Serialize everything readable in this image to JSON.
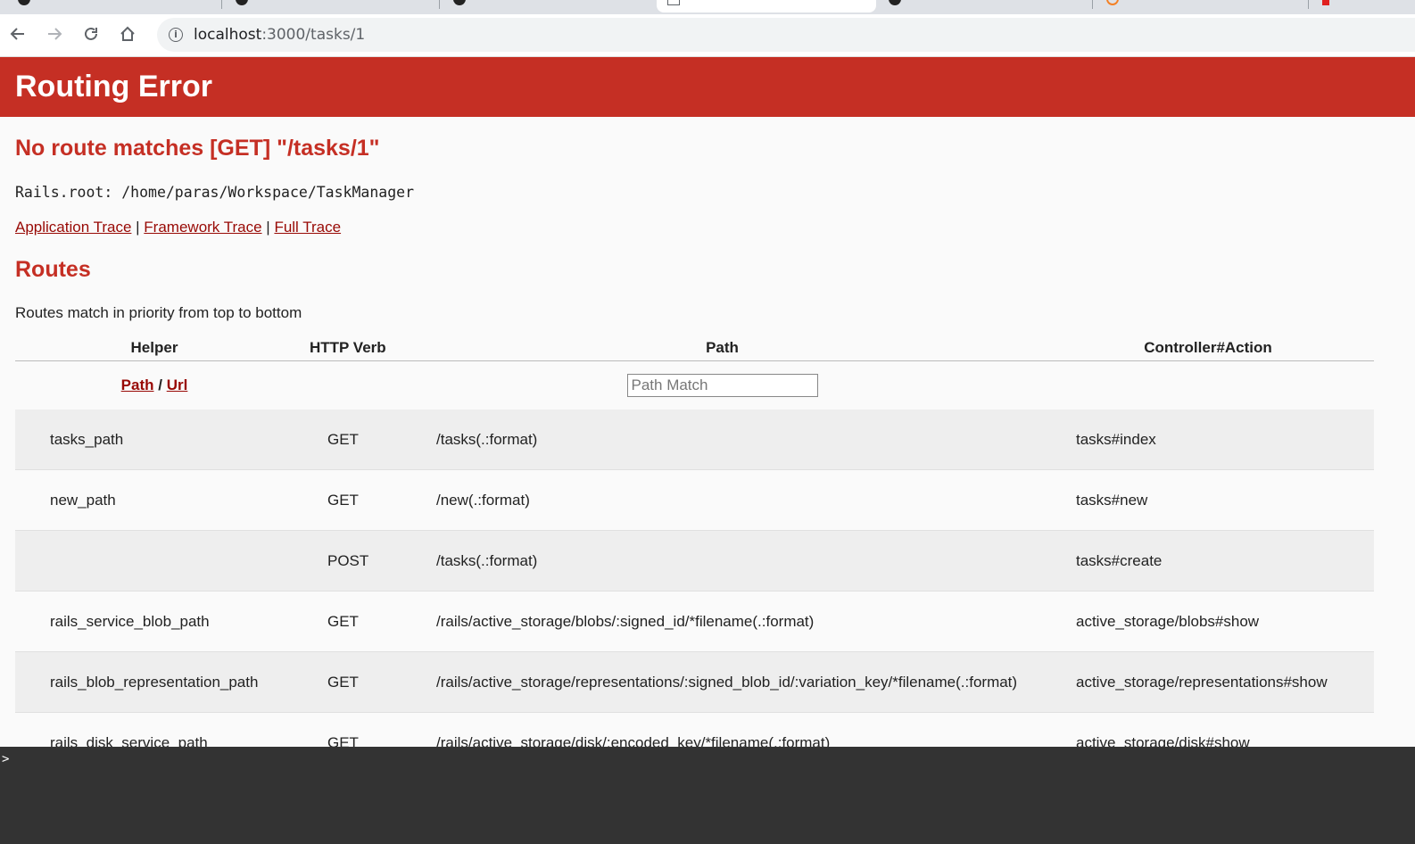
{
  "browser": {
    "url_host": "localhost",
    "url_rest": ":3000/tasks/1"
  },
  "page": {
    "header_title": "Routing Error",
    "message": "No route matches [GET] \"/tasks/1\"",
    "rails_root": "Rails.root: /home/paras/Workspace/TaskManager",
    "traces": {
      "application": "Application Trace",
      "framework": "Framework Trace",
      "full": "Full Trace",
      "separator": "|"
    },
    "routes_heading": "Routes",
    "routes_description": "Routes match in priority from top to bottom"
  },
  "routes_table": {
    "headers": {
      "helper": "Helper",
      "verb": "HTTP Verb",
      "path": "Path",
      "action": "Controller#Action"
    },
    "filter": {
      "path_link": "Path",
      "slash": "/",
      "url_link": "Url",
      "search_placeholder": "Path Match"
    },
    "rows": [
      {
        "helper": "tasks_path",
        "verb": "GET",
        "path": "/tasks(.:format)",
        "action": "tasks#index"
      },
      {
        "helper": "new_path",
        "verb": "GET",
        "path": "/new(.:format)",
        "action": "tasks#new"
      },
      {
        "helper": "",
        "verb": "POST",
        "path": "/tasks(.:format)",
        "action": "tasks#create"
      },
      {
        "helper": "rails_service_blob_path",
        "verb": "GET",
        "path": "/rails/active_storage/blobs/:signed_id/*filename(.:format)",
        "action": "active_storage/blobs#show"
      },
      {
        "helper": "rails_blob_representation_path",
        "verb": "GET",
        "path": "/rails/active_storage/representations/:signed_blob_id/:variation_key/*filename(.:format)",
        "action": "active_storage/representations#show"
      },
      {
        "helper": "rails_disk_service_path",
        "verb": "GET",
        "path": "/rails/active_storage/disk/:encoded_key/*filename(.:format)",
        "action": "active_storage/disk#show"
      }
    ]
  },
  "console": {
    "prompt": ">"
  },
  "colors": {
    "accent_red": "#c52f24",
    "link_red": "#980905",
    "console_bg": "#333333"
  }
}
